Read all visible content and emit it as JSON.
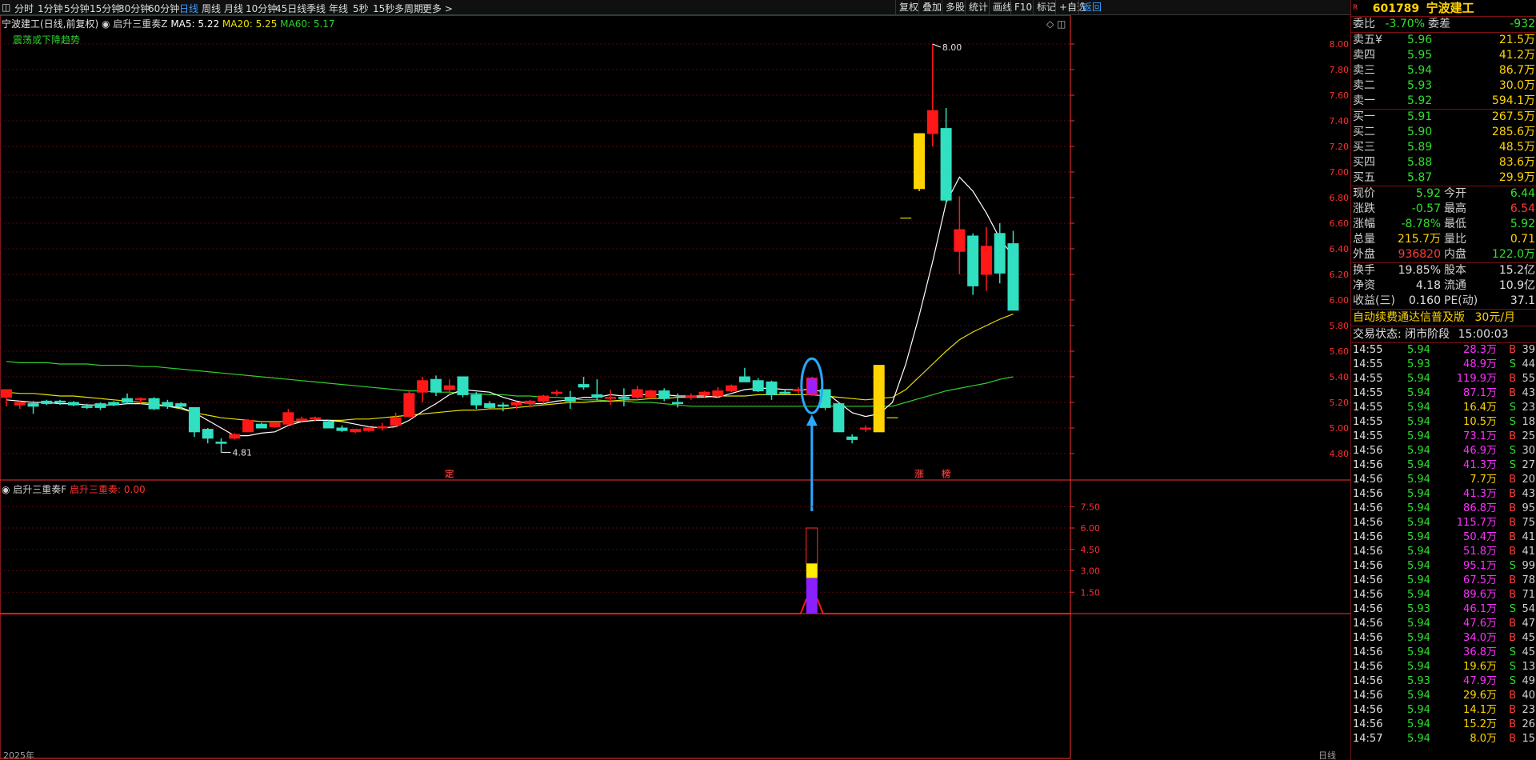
{
  "toolbar": {
    "periods": [
      "分时",
      "1分钟",
      "5分钟",
      "15分钟",
      "30分钟",
      "60分钟",
      "日线",
      "周线",
      "月线",
      "10分钟",
      "45日线",
      "季线",
      "年线",
      "5秒",
      "15秒",
      "多周期",
      "更多 >"
    ],
    "active_period": "日线",
    "right_buttons": [
      "复权",
      "叠加",
      "多股",
      "统计",
      "画线",
      "F10",
      "标记",
      "+自选",
      "返回"
    ]
  },
  "main_chart": {
    "header_name": "宁波建工(日线,前复权)",
    "indicator_name": "启升三重奏Z",
    "ma5_label": "MA5: 5.22",
    "ma20_label": "MA20: 5.25",
    "ma60_label": "MA60: 5.17",
    "trend_text": "震荡或下降趋势",
    "high_label": "8.00",
    "low_label": "4.81",
    "marker_ding": "定",
    "marker_zhang": "涨",
    "marker_bang": "榜",
    "colors": {
      "ma5": "#ffffff",
      "ma20": "#e8e000",
      "ma60": "#2fd02f",
      "up": "#ff1818",
      "down": "#30e0c0",
      "grid": "#5a0a0a",
      "axis": "#ff3030",
      "highlight": "#9a20ff",
      "yellow": "#ffd400",
      "circle": "#2aa8ff"
    }
  },
  "sub_chart": {
    "title": "启升三重奏F",
    "value_label": "启升三重奏: 0.00"
  },
  "bottom_axis": {
    "left_label": "2025年",
    "right_label": "日线"
  },
  "chart_data": {
    "type": "candlestick",
    "ylim": [
      4.6,
      8.1
    ],
    "yticks": [
      "8.00",
      "7.80",
      "7.60",
      "7.40",
      "7.20",
      "7.00",
      "6.80",
      "6.60",
      "6.40",
      "6.20",
      "6.00",
      "5.80",
      "5.60",
      "5.40",
      "5.20",
      "5.00",
      "4.80"
    ],
    "candles": [
      {
        "o": 5.24,
        "h": 5.3,
        "l": 5.17,
        "c": 5.3
      },
      {
        "o": 5.18,
        "h": 5.21,
        "l": 5.15,
        "c": 5.2
      },
      {
        "o": 5.19,
        "h": 5.21,
        "l": 5.11,
        "c": 5.17
      },
      {
        "o": 5.21,
        "h": 5.22,
        "l": 5.18,
        "c": 5.19
      },
      {
        "o": 5.21,
        "h": 5.22,
        "l": 5.18,
        "c": 5.2
      },
      {
        "o": 5.2,
        "h": 5.21,
        "l": 5.17,
        "c": 5.18
      },
      {
        "o": 5.17,
        "h": 5.19,
        "l": 5.15,
        "c": 5.16
      },
      {
        "o": 5.19,
        "h": 5.2,
        "l": 5.14,
        "c": 5.16
      },
      {
        "o": 5.2,
        "h": 5.21,
        "l": 5.17,
        "c": 5.18
      },
      {
        "o": 5.23,
        "h": 5.27,
        "l": 5.19,
        "c": 5.2
      },
      {
        "o": 5.22,
        "h": 5.24,
        "l": 5.19,
        "c": 5.23
      },
      {
        "o": 5.23,
        "h": 5.24,
        "l": 5.14,
        "c": 5.15
      },
      {
        "o": 5.2,
        "h": 5.22,
        "l": 5.15,
        "c": 5.17
      },
      {
        "o": 5.19,
        "h": 5.2,
        "l": 5.15,
        "c": 5.17
      },
      {
        "o": 5.16,
        "h": 5.16,
        "l": 4.93,
        "c": 4.97
      },
      {
        "o": 4.99,
        "h": 5.0,
        "l": 4.88,
        "c": 4.92
      },
      {
        "o": 4.89,
        "h": 4.92,
        "l": 4.81,
        "c": 4.88
      },
      {
        "o": 4.92,
        "h": 4.96,
        "l": 4.91,
        "c": 4.95
      },
      {
        "o": 4.97,
        "h": 5.07,
        "l": 4.97,
        "c": 5.06
      },
      {
        "o": 5.03,
        "h": 5.04,
        "l": 5.0,
        "c": 5.0
      },
      {
        "o": 5.01,
        "h": 5.04,
        "l": 5.0,
        "c": 5.04
      },
      {
        "o": 5.03,
        "h": 5.15,
        "l": 5.02,
        "c": 5.12
      },
      {
        "o": 5.06,
        "h": 5.09,
        "l": 5.05,
        "c": 5.07
      },
      {
        "o": 5.07,
        "h": 5.09,
        "l": 5.05,
        "c": 5.08
      },
      {
        "o": 5.05,
        "h": 5.06,
        "l": 5.02,
        "c": 5.0
      },
      {
        "o": 5.0,
        "h": 5.02,
        "l": 4.97,
        "c": 4.98
      },
      {
        "o": 4.97,
        "h": 4.99,
        "l": 4.96,
        "c": 4.99
      },
      {
        "o": 4.98,
        "h": 5.01,
        "l": 4.97,
        "c": 5.0
      },
      {
        "o": 5.0,
        "h": 5.04,
        "l": 4.98,
        "c": 5.01
      },
      {
        "o": 5.02,
        "h": 5.12,
        "l": 5.01,
        "c": 5.08
      },
      {
        "o": 5.09,
        "h": 5.3,
        "l": 5.08,
        "c": 5.27
      },
      {
        "o": 5.28,
        "h": 5.4,
        "l": 5.2,
        "c": 5.37
      },
      {
        "o": 5.38,
        "h": 5.41,
        "l": 5.25,
        "c": 5.28
      },
      {
        "o": 5.3,
        "h": 5.38,
        "l": 5.26,
        "c": 5.33
      },
      {
        "o": 5.4,
        "h": 5.4,
        "l": 5.24,
        "c": 5.26
      },
      {
        "o": 5.26,
        "h": 5.28,
        "l": 5.15,
        "c": 5.18
      },
      {
        "o": 5.19,
        "h": 5.21,
        "l": 5.15,
        "c": 5.16
      },
      {
        "o": 5.18,
        "h": 5.2,
        "l": 5.13,
        "c": 5.17
      },
      {
        "o": 5.18,
        "h": 5.2,
        "l": 5.15,
        "c": 5.2
      },
      {
        "o": 5.19,
        "h": 5.22,
        "l": 5.16,
        "c": 5.21
      },
      {
        "o": 5.21,
        "h": 5.26,
        "l": 5.19,
        "c": 5.25
      },
      {
        "o": 5.27,
        "h": 5.3,
        "l": 5.25,
        "c": 5.28
      },
      {
        "o": 5.24,
        "h": 5.29,
        "l": 5.15,
        "c": 5.21
      },
      {
        "o": 5.34,
        "h": 5.4,
        "l": 5.3,
        "c": 5.32
      },
      {
        "o": 5.26,
        "h": 5.38,
        "l": 5.22,
        "c": 5.24
      },
      {
        "o": 5.24,
        "h": 5.3,
        "l": 5.18,
        "c": 5.24
      },
      {
        "o": 5.24,
        "h": 5.31,
        "l": 5.17,
        "c": 5.23
      },
      {
        "o": 5.24,
        "h": 5.33,
        "l": 5.22,
        "c": 5.3
      },
      {
        "o": 5.24,
        "h": 5.3,
        "l": 5.23,
        "c": 5.29
      },
      {
        "o": 5.29,
        "h": 5.31,
        "l": 5.21,
        "c": 5.23
      },
      {
        "o": 5.2,
        "h": 5.27,
        "l": 5.16,
        "c": 5.19
      },
      {
        "o": 5.24,
        "h": 5.27,
        "l": 5.22,
        "c": 5.25
      },
      {
        "o": 5.26,
        "h": 5.29,
        "l": 5.24,
        "c": 5.28
      },
      {
        "o": 5.25,
        "h": 5.32,
        "l": 5.24,
        "c": 5.29
      },
      {
        "o": 5.29,
        "h": 5.34,
        "l": 5.28,
        "c": 5.33
      },
      {
        "o": 5.4,
        "h": 5.47,
        "l": 5.36,
        "c": 5.36
      },
      {
        "o": 5.37,
        "h": 5.39,
        "l": 5.28,
        "c": 5.29
      },
      {
        "o": 5.36,
        "h": 5.37,
        "l": 5.22,
        "c": 5.26
      },
      {
        "o": 5.28,
        "h": 5.3,
        "l": 5.26,
        "c": 5.27
      },
      {
        "o": 5.29,
        "h": 5.32,
        "l": 5.27,
        "c": 5.3
      },
      {
        "o": 5.26,
        "h": 5.4,
        "l": 5.25,
        "c": 5.39,
        "hl": true
      },
      {
        "o": 5.3,
        "h": 5.3,
        "l": 5.14,
        "c": 5.16
      },
      {
        "o": 5.19,
        "h": 5.2,
        "l": 4.97,
        "c": 4.97
      },
      {
        "o": 4.93,
        "h": 4.95,
        "l": 4.88,
        "c": 4.91
      },
      {
        "o": 5.0,
        "h": 5.02,
        "l": 4.97,
        "c": 5.0
      },
      {
        "o": 4.97,
        "h": 5.49,
        "l": 4.97,
        "c": 5.49,
        "gold": true
      },
      {
        "o": 5.08,
        "h": 5.08,
        "l": 5.08,
        "c": 5.08,
        "dash": true
      },
      {
        "o": 6.64,
        "h": 6.64,
        "l": 6.64,
        "c": 6.64,
        "dash": true
      },
      {
        "o": 6.87,
        "h": 7.3,
        "l": 6.85,
        "c": 7.3,
        "gold": true
      },
      {
        "o": 7.3,
        "h": 8.0,
        "l": 7.2,
        "c": 7.48
      },
      {
        "o": 7.34,
        "h": 7.5,
        "l": 6.75,
        "c": 6.78
      },
      {
        "o": 6.38,
        "h": 6.81,
        "l": 6.2,
        "c": 6.55
      },
      {
        "o": 6.5,
        "h": 6.52,
        "l": 6.04,
        "c": 6.11
      },
      {
        "o": 6.2,
        "h": 6.57,
        "l": 6.07,
        "c": 6.42
      },
      {
        "o": 6.52,
        "h": 6.6,
        "l": 6.13,
        "c": 6.21
      },
      {
        "o": 6.44,
        "h": 6.54,
        "l": 5.92,
        "c": 5.92
      }
    ],
    "ma5": [
      5.22,
      5.21,
      5.2,
      5.2,
      5.19,
      5.19,
      5.18,
      5.18,
      5.18,
      5.19,
      5.19,
      5.18,
      5.17,
      5.16,
      5.12,
      5.06,
      5.0,
      4.94,
      4.94,
      4.96,
      4.97,
      5.02,
      5.05,
      5.06,
      5.06,
      5.05,
      5.03,
      5.01,
      5.0,
      5.01,
      5.06,
      5.13,
      5.19,
      5.26,
      5.3,
      5.29,
      5.28,
      5.24,
      5.21,
      5.19,
      5.19,
      5.21,
      5.22,
      5.24,
      5.24,
      5.26,
      5.25,
      5.26,
      5.26,
      5.26,
      5.25,
      5.25,
      5.25,
      5.24,
      5.27,
      5.3,
      5.31,
      5.31,
      5.3,
      5.3,
      5.3,
      5.28,
      5.2,
      5.12,
      5.09,
      5.11,
      5.2,
      5.5,
      5.88,
      6.3,
      6.76,
      6.96,
      6.85,
      6.68,
      6.48,
      6.34
    ],
    "ma20": [
      5.28,
      5.27,
      5.27,
      5.26,
      5.25,
      5.25,
      5.24,
      5.23,
      5.22,
      5.21,
      5.2,
      5.19,
      5.17,
      5.15,
      5.12,
      5.1,
      5.08,
      5.07,
      5.06,
      5.05,
      5.05,
      5.05,
      5.05,
      5.06,
      5.06,
      5.06,
      5.07,
      5.07,
      5.08,
      5.09,
      5.1,
      5.11,
      5.12,
      5.13,
      5.14,
      5.14,
      5.15,
      5.15,
      5.16,
      5.17,
      5.18,
      5.19,
      5.2,
      5.2,
      5.21,
      5.21,
      5.22,
      5.22,
      5.23,
      5.23,
      5.24,
      5.24,
      5.24,
      5.25,
      5.25,
      5.25,
      5.26,
      5.26,
      5.26,
      5.26,
      5.26,
      5.25,
      5.24,
      5.23,
      5.22,
      5.23,
      5.24,
      5.3,
      5.4,
      5.5,
      5.6,
      5.69,
      5.75,
      5.8,
      5.85,
      5.89
    ],
    "ma60": [
      5.52,
      5.51,
      5.51,
      5.51,
      5.5,
      5.5,
      5.5,
      5.49,
      5.49,
      5.49,
      5.48,
      5.48,
      5.47,
      5.46,
      5.45,
      5.44,
      5.43,
      5.42,
      5.41,
      5.4,
      5.39,
      5.38,
      5.37,
      5.36,
      5.35,
      5.34,
      5.33,
      5.32,
      5.31,
      5.3,
      5.29,
      5.29,
      5.28,
      5.28,
      5.27,
      5.27,
      5.26,
      5.26,
      5.25,
      5.25,
      5.24,
      5.24,
      5.23,
      5.22,
      5.22,
      5.21,
      5.21,
      5.2,
      5.2,
      5.19,
      5.18,
      5.17,
      5.17,
      5.17,
      5.17,
      5.17,
      5.17,
      5.17,
      5.17,
      5.17,
      5.17,
      5.17,
      5.17,
      5.17,
      5.17,
      5.17,
      5.17,
      5.2,
      5.23,
      5.26,
      5.29,
      5.31,
      5.33,
      5.35,
      5.38,
      5.4
    ],
    "sub_axis_ticks": [
      "7.50",
      "6.00",
      "4.50",
      "3.00",
      "1.50"
    ],
    "sub_ylim": [
      0,
      8.3
    ],
    "sub_bar": {
      "index": 60,
      "purple": 2.5,
      "yellow": 3.5,
      "empty": 6.0
    }
  },
  "quote_panel": {
    "code": "601789",
    "name": "宁波建工",
    "tag": "R",
    "webi_label": "委比",
    "webi_value": "-3.70%",
    "weicha_label": "委差",
    "weicha_value": "-932",
    "asks": [
      {
        "label": "卖五¥",
        "price": "5.96",
        "vol": "21.5万"
      },
      {
        "label": "卖四",
        "price": "5.95",
        "vol": "41.2万"
      },
      {
        "label": "卖三",
        "price": "5.94",
        "vol": "86.7万"
      },
      {
        "label": "卖二",
        "price": "5.93",
        "vol": "30.0万"
      },
      {
        "label": "卖一",
        "price": "5.92",
        "vol": "594.1万"
      }
    ],
    "bids": [
      {
        "label": "买一",
        "price": "5.91",
        "vol": "267.5万"
      },
      {
        "label": "买二",
        "price": "5.90",
        "vol": "285.6万"
      },
      {
        "label": "买三",
        "price": "5.89",
        "vol": "48.5万"
      },
      {
        "label": "买四",
        "price": "5.88",
        "vol": "83.6万"
      },
      {
        "label": "买五",
        "price": "5.87",
        "vol": "29.9万"
      }
    ],
    "stats1": [
      {
        "l1": "现价",
        "v1": "5.92",
        "c1": "green",
        "l2": "今开",
        "v2": "6.44",
        "c2": "green"
      },
      {
        "l1": "涨跌",
        "v1": "-0.57",
        "c1": "green",
        "l2": "最高",
        "v2": "6.54",
        "c2": "red"
      },
      {
        "l1": "涨幅",
        "v1": "-8.78%",
        "c1": "green",
        "l2": "最低",
        "v2": "5.92",
        "c2": "green"
      },
      {
        "l1": "总量",
        "v1": "215.7万",
        "c1": "yellow",
        "l2": "量比",
        "v2": "0.71",
        "c2": "yellow"
      },
      {
        "l1": "外盘",
        "v1": "936820",
        "c1": "red",
        "l2": "内盘",
        "v2": "122.0万",
        "c2": "green"
      }
    ],
    "stats2": [
      {
        "l1": "换手",
        "v1": "19.85%",
        "c1": "white",
        "l2": "股本",
        "v2": "15.2亿",
        "c2": "white"
      },
      {
        "l1": "净资",
        "v1": "4.18",
        "c1": "white",
        "l2": "流通",
        "v2": "10.9亿",
        "c2": "white"
      },
      {
        "l1": "收益(三)",
        "v1": "0.160",
        "c1": "white",
        "l2": "PE(动)",
        "v2": "37.1",
        "c2": "white"
      }
    ],
    "promo_text": "自动续费通达信普及版",
    "promo_price": "30元/月",
    "status_label": "交易状态: 闭市阶段",
    "status_time": "15:00:03"
  },
  "ticks": [
    {
      "t": "14:55",
      "p": "5.94",
      "pc": "green",
      "v": "28.3万",
      "vc": "magenta",
      "bs": "B",
      "n": "39"
    },
    {
      "t": "14:55",
      "p": "5.93",
      "pc": "green",
      "v": "48.9万",
      "vc": "magenta",
      "bs": "S",
      "n": "44"
    },
    {
      "t": "14:55",
      "p": "5.94",
      "pc": "green",
      "v": "119.9万",
      "vc": "magenta",
      "bs": "B",
      "n": "55"
    },
    {
      "t": "14:55",
      "p": "5.94",
      "pc": "green",
      "v": "87.1万",
      "vc": "magenta",
      "bs": "B",
      "n": "43"
    },
    {
      "t": "14:55",
      "p": "5.94",
      "pc": "green",
      "v": "16.4万",
      "vc": "yellow",
      "bs": "S",
      "n": "23"
    },
    {
      "t": "14:55",
      "p": "5.94",
      "pc": "green",
      "v": "10.5万",
      "vc": "yellow",
      "bs": "S",
      "n": "18"
    },
    {
      "t": "14:55",
      "p": "5.94",
      "pc": "green",
      "v": "73.1万",
      "vc": "magenta",
      "bs": "B",
      "n": "25"
    },
    {
      "t": "14:56",
      "p": "5.94",
      "pc": "green",
      "v": "46.9万",
      "vc": "magenta",
      "bs": "S",
      "n": "30"
    },
    {
      "t": "14:56",
      "p": "5.94",
      "pc": "green",
      "v": "41.3万",
      "vc": "magenta",
      "bs": "S",
      "n": "27"
    },
    {
      "t": "14:56",
      "p": "5.94",
      "pc": "green",
      "v": "7.7万",
      "vc": "yellow",
      "bs": "B",
      "n": "20"
    },
    {
      "t": "14:56",
      "p": "5.94",
      "pc": "green",
      "v": "41.3万",
      "vc": "magenta",
      "bs": "B",
      "n": "43"
    },
    {
      "t": "14:56",
      "p": "5.94",
      "pc": "green",
      "v": "86.8万",
      "vc": "magenta",
      "bs": "B",
      "n": "95"
    },
    {
      "t": "14:56",
      "p": "5.94",
      "pc": "green",
      "v": "115.7万",
      "vc": "magenta",
      "bs": "B",
      "n": "75"
    },
    {
      "t": "14:56",
      "p": "5.94",
      "pc": "green",
      "v": "50.4万",
      "vc": "magenta",
      "bs": "B",
      "n": "41"
    },
    {
      "t": "14:56",
      "p": "5.94",
      "pc": "green",
      "v": "51.8万",
      "vc": "magenta",
      "bs": "B",
      "n": "41"
    },
    {
      "t": "14:56",
      "p": "5.94",
      "pc": "green",
      "v": "95.1万",
      "vc": "magenta",
      "bs": "S",
      "n": "99"
    },
    {
      "t": "14:56",
      "p": "5.94",
      "pc": "green",
      "v": "67.5万",
      "vc": "magenta",
      "bs": "B",
      "n": "78"
    },
    {
      "t": "14:56",
      "p": "5.94",
      "pc": "green",
      "v": "89.6万",
      "vc": "magenta",
      "bs": "B",
      "n": "71"
    },
    {
      "t": "14:56",
      "p": "5.93",
      "pc": "green",
      "v": "46.1万",
      "vc": "magenta",
      "bs": "S",
      "n": "54"
    },
    {
      "t": "14:56",
      "p": "5.94",
      "pc": "green",
      "v": "47.6万",
      "vc": "magenta",
      "bs": "B",
      "n": "47"
    },
    {
      "t": "14:56",
      "p": "5.94",
      "pc": "green",
      "v": "34.0万",
      "vc": "magenta",
      "bs": "B",
      "n": "45"
    },
    {
      "t": "14:56",
      "p": "5.94",
      "pc": "green",
      "v": "36.8万",
      "vc": "magenta",
      "bs": "S",
      "n": "45"
    },
    {
      "t": "14:56",
      "p": "5.94",
      "pc": "green",
      "v": "19.6万",
      "vc": "yellow",
      "bs": "S",
      "n": "13"
    },
    {
      "t": "14:56",
      "p": "5.93",
      "pc": "green",
      "v": "47.9万",
      "vc": "magenta",
      "bs": "S",
      "n": "49"
    },
    {
      "t": "14:56",
      "p": "5.94",
      "pc": "green",
      "v": "29.6万",
      "vc": "yellow",
      "bs": "B",
      "n": "40"
    },
    {
      "t": "14:56",
      "p": "5.94",
      "pc": "green",
      "v": "14.1万",
      "vc": "yellow",
      "bs": "B",
      "n": "23"
    },
    {
      "t": "14:56",
      "p": "5.94",
      "pc": "green",
      "v": "15.2万",
      "vc": "yellow",
      "bs": "B",
      "n": "26"
    },
    {
      "t": "14:57",
      "p": "5.94",
      "pc": "green",
      "v": "8.0万",
      "vc": "yellow",
      "bs": "B",
      "n": "15"
    }
  ]
}
